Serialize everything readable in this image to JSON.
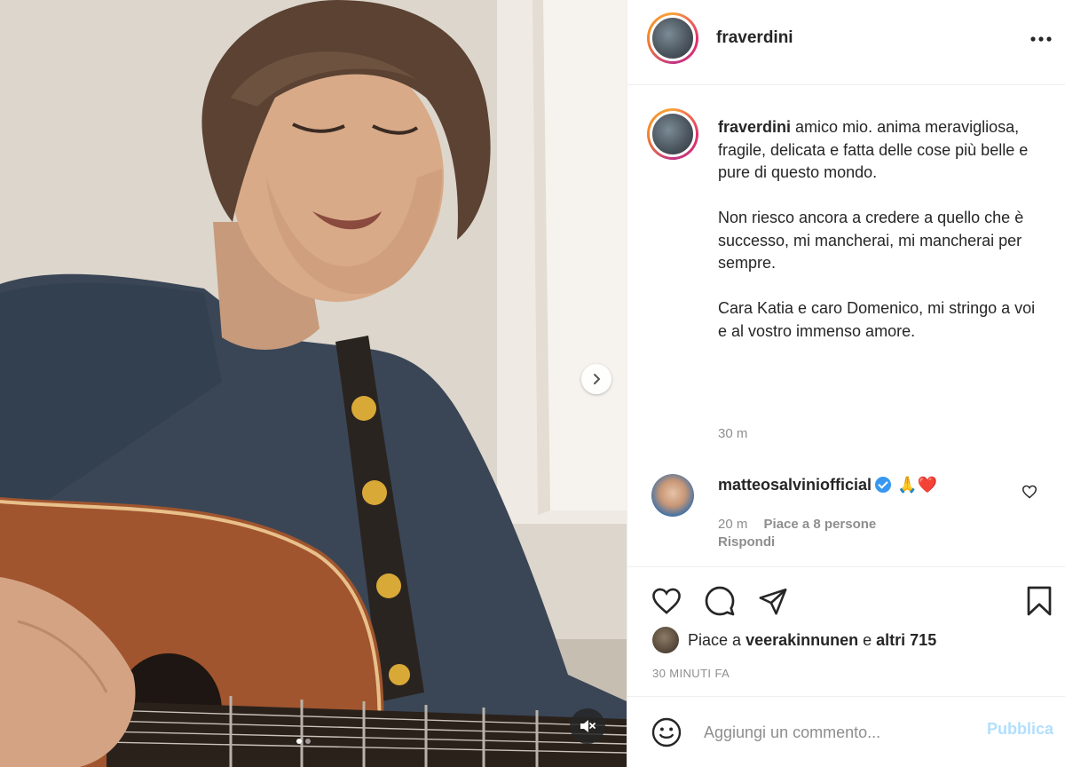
{
  "media": {
    "next_icon": "chevron-right-icon",
    "mute_icon": "speaker-muted-icon",
    "carousel_pages": 2,
    "carousel_active_page": 1
  },
  "header": {
    "username": "fraverdini",
    "more_icon": "more-horizontal-icon"
  },
  "caption": {
    "username": "fraverdini",
    "paragraph1": "amico mio. anima meravigliosa, fragile, delicata e fatta delle cose più belle e pure di questo mondo.",
    "paragraph2": "Non riesco ancora a credere a quello che è successo, mi mancherai, mi mancherai per sempre.",
    "paragraph3": "Cara Katia e caro Domenico, mi stringo a voi e al vostro immenso amore.",
    "time": "30 m"
  },
  "comment": {
    "username": "matteosalviniofficial",
    "verified": true,
    "text": "🙏❤️",
    "time": "20 m",
    "likes_text": "Piace a 8 persone",
    "reply_label": "Rispondi"
  },
  "actions": {
    "like_icon": "heart-icon",
    "comment_icon": "comment-bubble-icon",
    "share_icon": "paper-plane-icon",
    "save_icon": "bookmark-icon"
  },
  "likes": {
    "prefix": "Piace a",
    "user": "veerakinnunen",
    "connector": "e",
    "others": "altri 715"
  },
  "posted_time": "30 MINUTI FA",
  "add_comment": {
    "placeholder": "Aggiungi un commento...",
    "publish_label": "Pubblica",
    "publish_color": "#b2dffc"
  }
}
